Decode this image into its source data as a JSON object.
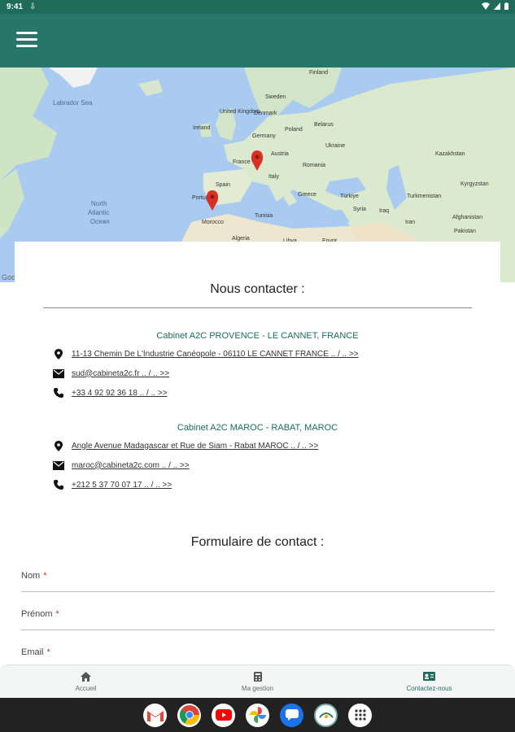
{
  "status_bar": {
    "time": "9:41",
    "download_icon": "download-icon"
  },
  "app_bar": {
    "menu_icon": "menu-icon"
  },
  "map": {
    "labels": {
      "finland": "Finland",
      "sweden": "Sweden",
      "labrador_sea": "Labrador Sea",
      "denmark": "Denmark",
      "united_kingdom": "United Kingdom",
      "ireland": "Ireland",
      "poland": "Poland",
      "belarus": "Belarus",
      "germany": "Germany",
      "ukraine": "Ukraine",
      "france": "France",
      "austria": "Austria",
      "romania": "Romania",
      "italy": "Italy",
      "kazakhstan": "Kazakhstan",
      "spain": "Spain",
      "portugal": "Portugal",
      "greece": "Greece",
      "turkiye": "Türkiye",
      "turkmenistan": "Turkmenistan",
      "kyrgyzstan": "Kyrgyzstan",
      "north_atlantic_ocean": [
        "North",
        "Atlantic",
        "Ocean"
      ],
      "tunisia": "Tunisia",
      "syria": "Syria",
      "iraq": "Iraq",
      "iran": "Iran",
      "afghanistan": "Afghanistan",
      "morocco": "Morocco",
      "pakistan": "Pakistan",
      "algeria": "Algeria",
      "libya": "Libya",
      "egypt": "Egypt"
    },
    "brand": "Google"
  },
  "contact": {
    "title": "Nous contacter :",
    "offices": [
      {
        "name": "Cabinet A2C PROVENCE - LE CANNET, FRANCE",
        "address": "11-13 Chemin De L'Industrie Canéopole - 06110 LE CANNET FRANCE .. / .. >>",
        "email": "sud@cabineta2c.fr .. / .. >>",
        "phone": "+33 4 92 92 36 18 .. / .. >>"
      },
      {
        "name": "Cabinet A2C MAROC - RABAT, MAROC",
        "address": "Angle Avenue Madagascar et Rue de Siam - Rabat MAROC .. / .. >>",
        "email": "maroc@cabineta2c.com .. / .. >>",
        "phone": "+212 5 37 70 07 17 .. / .. >>"
      }
    ]
  },
  "form": {
    "title": "Formulaire de contact :",
    "fields": [
      {
        "label": "Nom",
        "required_mark": "*"
      },
      {
        "label": "Prénom",
        "required_mark": "*"
      },
      {
        "label": "Email",
        "required_mark": "*"
      }
    ]
  },
  "bottom_nav": {
    "items": [
      {
        "label": "Accueil",
        "icon": "home-icon"
      },
      {
        "label": "Ma gestion",
        "icon": "calculator-icon"
      },
      {
        "label": "Contactez-nous",
        "icon": "contact-card-icon",
        "active": true
      }
    ]
  },
  "taskbar": {
    "apps": [
      "gmail-icon",
      "chrome-icon",
      "youtube-icon",
      "photos-icon",
      "messages-icon",
      "a2c-app-icon",
      "app-drawer-icon"
    ]
  },
  "colors": {
    "primary": "#26776a",
    "accent_text": "#1f6b5a",
    "required": "#d32f2f",
    "pin": "#d93025"
  }
}
